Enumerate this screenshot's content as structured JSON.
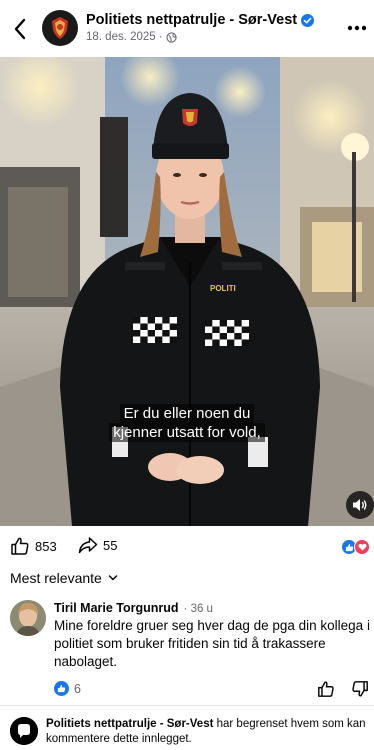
{
  "header": {
    "page_name": "Politiets nettpatrulje - Sør-Vest",
    "date": "18. des. 2025 ·",
    "icons": {
      "back": "back-arrow-icon",
      "verified": "verified-badge-icon",
      "audience": "globe-icon",
      "more": "more-dots-icon"
    }
  },
  "video": {
    "caption_line1": "Er du eller noen du",
    "caption_line2": "kjenner utsatt for vold,",
    "jacket_text": "POLITI",
    "sound_icon": "speaker-icon"
  },
  "reactions": {
    "like_count": "853",
    "share_count": "55",
    "react_types": [
      "like",
      "love"
    ]
  },
  "comments": {
    "sort_label": "Mest relevante",
    "items": [
      {
        "author": "Tiril Marie Torgunrud",
        "time": "· 36 u",
        "text": "Mine foreldre gruer seg hver dag de pga din kollega i politiet som bruker fritiden sin tid å trakassere nabolaget.",
        "like_count": "6"
      }
    ]
  },
  "footer": {
    "page_name": "Politiets nettpatrulje - Sør-Vest",
    "notice": " har begrenset hvem som kan kommentere dette innlegget."
  },
  "colors": {
    "facebook_blue": "#1877f2",
    "love_red": "#f33e58",
    "secondary_text": "#65676b"
  }
}
